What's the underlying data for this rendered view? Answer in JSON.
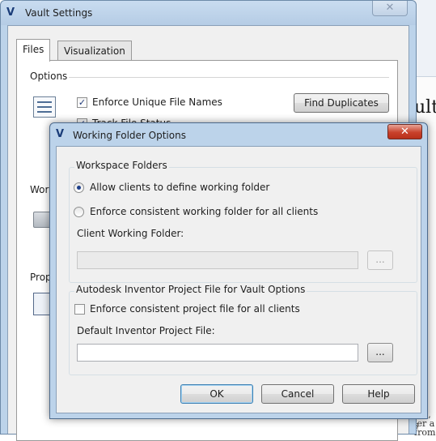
{
  "background_app": {
    "text_big": "ult",
    "text_small": [
      "ion, s",
      "ier a",
      "from"
    ]
  },
  "vault_settings": {
    "title": "Vault Settings",
    "close_glyph": "✕",
    "tabs": [
      {
        "label": "Files",
        "active": true
      },
      {
        "label": "Visualization",
        "active": false
      }
    ],
    "options": {
      "group_label": "Options",
      "enforce_unique": {
        "label": "Enforce Unique File Names",
        "checked": true
      },
      "track_status": {
        "label": "Track File Status",
        "checked": true
      },
      "find_duplicates_label": "Find Duplicates"
    },
    "working_folder_group_label": "Work",
    "project_group_label": "Prop"
  },
  "working_folder_options": {
    "title": "Working Folder Options",
    "close_glyph": "✕",
    "workspace_folders": {
      "legend": "Workspace Folders",
      "allow_clients": {
        "label": "Allow clients to define working folder",
        "selected": true
      },
      "enforce_consistent": {
        "label": "Enforce consistent working folder for all clients",
        "selected": false
      },
      "client_working_folder_label": "Client Working Folder:",
      "client_working_folder_value": "",
      "browse_label": "..."
    },
    "inventor": {
      "legend": "Autodesk Inventor Project File for Vault Options",
      "enforce_project": {
        "label": "Enforce consistent project file for all clients",
        "checked": false
      },
      "default_project_label": "Default Inventor Project File:",
      "default_project_value": "",
      "browse_label": "..."
    },
    "buttons": {
      "ok": "OK",
      "cancel": "Cancel",
      "help": "Help"
    }
  },
  "colors": {
    "window_frame": "#bcd3ea",
    "close_button_red": "#c8412b",
    "dialog_surface": "#f0f0f0"
  },
  "icons": [
    "vault-logo-icon",
    "options-list-icon",
    "folder-icon",
    "project-file-icon",
    "close-icon",
    "checkbox-check-icon"
  ]
}
